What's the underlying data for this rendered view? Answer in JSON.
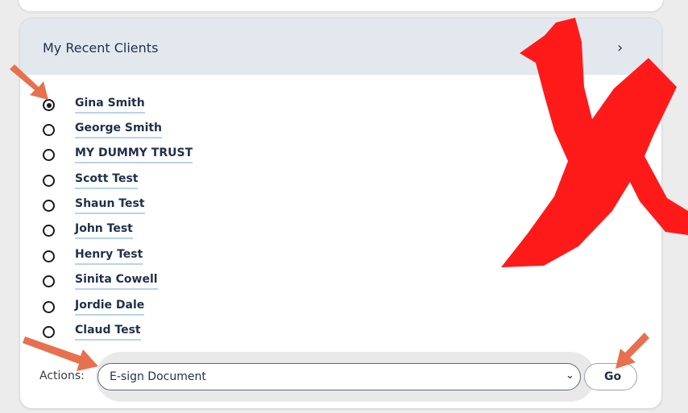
{
  "panel": {
    "title": "My Recent Clients",
    "chevron_glyph": "›"
  },
  "clients": [
    {
      "name": "Gina Smith",
      "selected": true
    },
    {
      "name": "George Smith",
      "selected": false
    },
    {
      "name": "MY DUMMY TRUST",
      "selected": false
    },
    {
      "name": "Scott Test",
      "selected": false
    },
    {
      "name": "Shaun Test",
      "selected": false
    },
    {
      "name": "John Test",
      "selected": false
    },
    {
      "name": "Henry Test",
      "selected": false
    },
    {
      "name": "Sinita Cowell",
      "selected": false
    },
    {
      "name": "Jordie Dale",
      "selected": false
    },
    {
      "name": "Claud Test",
      "selected": false
    }
  ],
  "actions": {
    "label": "Actions:",
    "selected_value": "E-sign Document",
    "caret_glyph": "⌄",
    "go_label": "Go"
  },
  "annotations": {
    "arrow_color": "#e8704e",
    "cross_color": "#ff1a1a"
  }
}
